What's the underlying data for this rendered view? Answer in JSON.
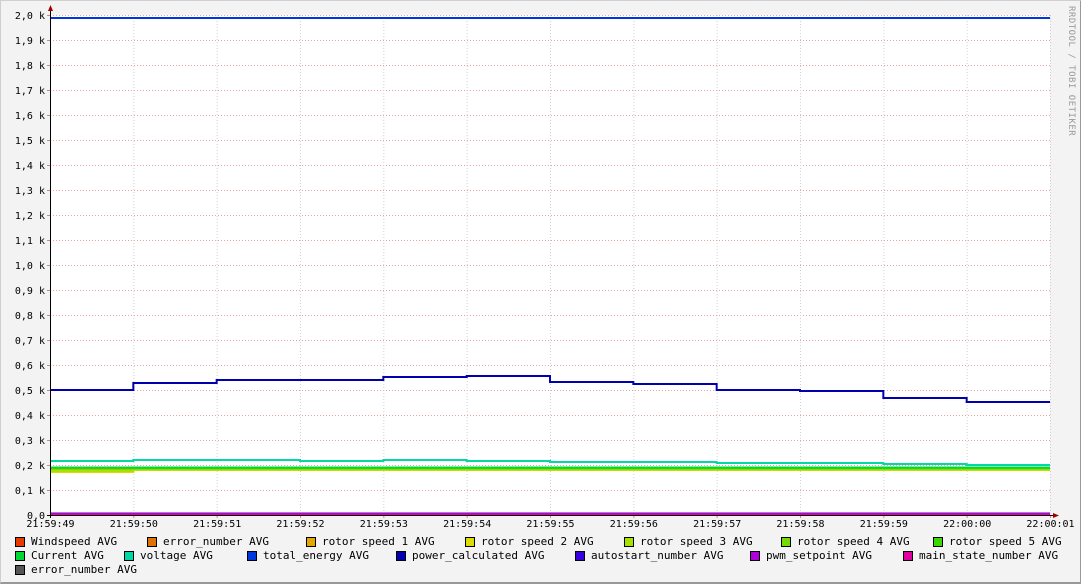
{
  "chart_data": {
    "type": "line",
    "title": "",
    "xlabel": "",
    "ylabel": "",
    "ylim": [
      0,
      2000
    ],
    "yticks": [
      0,
      100,
      200,
      300,
      400,
      500,
      600,
      700,
      800,
      900,
      1000,
      1100,
      1200,
      1300,
      1400,
      1500,
      1600,
      1700,
      1800,
      1900,
      2000
    ],
    "ytick_labels": [
      "0,0",
      "0,1 k",
      "0,2 k",
      "0,3 k",
      "0,4 k",
      "0,5 k",
      "0,6 k",
      "0,7 k",
      "0,8 k",
      "0,9 k",
      "1,0 k",
      "1,1 k",
      "1,2 k",
      "1,3 k",
      "1,4 k",
      "1,5 k",
      "1,6 k",
      "1,7 k",
      "1,8 k",
      "1,9 k",
      "2,0 k"
    ],
    "x": [
      "21:59:49",
      "21:59:50",
      "21:59:51",
      "21:59:52",
      "21:59:53",
      "21:59:54",
      "21:59:55",
      "21:59:56",
      "21:59:57",
      "21:59:58",
      "21:59:59",
      "22:00:00",
      "22:00:01"
    ],
    "grid": true,
    "legend_position": "bottom",
    "watermark": "RRDTOOL / TOBI OETIKER",
    "series": [
      {
        "name": "Windspeed AVG",
        "color": "#e83a00",
        "values": [
          null,
          null,
          null,
          null,
          null,
          null,
          null,
          null,
          null,
          null,
          null,
          null
        ]
      },
      {
        "name": "error_number AVG",
        "color": "#e07000",
        "values": [
          null,
          null,
          null,
          null,
          null,
          null,
          null,
          null,
          null,
          null,
          null,
          null
        ]
      },
      {
        "name": "rotor speed 1 AVG",
        "color": "#e0a800",
        "values": [
          184,
          184,
          184,
          184,
          184,
          184,
          184,
          184,
          184,
          184,
          184,
          184
        ]
      },
      {
        "name": "rotor speed 2 AVG",
        "color": "#dcdc00",
        "values": [
          172,
          180,
          180,
          180,
          180,
          180,
          180,
          180,
          180,
          180,
          180,
          180
        ]
      },
      {
        "name": "rotor speed 3 AVG",
        "color": "#a8e000",
        "values": [
          176,
          182,
          182,
          182,
          182,
          182,
          182,
          182,
          182,
          182,
          182,
          182
        ]
      },
      {
        "name": "rotor speed 4 AVG",
        "color": "#70dc00",
        "values": [
          186,
          186,
          186,
          186,
          186,
          186,
          186,
          186,
          186,
          186,
          186,
          186
        ]
      },
      {
        "name": "rotor speed 5 AVG",
        "color": "#38d800",
        "values": [
          188,
          188,
          188,
          188,
          188,
          188,
          188,
          188,
          188,
          188,
          188,
          188
        ]
      },
      {
        "name": "Current AVG",
        "color": "#00d838",
        "values": [
          190,
          190,
          190,
          190,
          190,
          190,
          190,
          190,
          190,
          190,
          190,
          190
        ]
      },
      {
        "name": "voltage AVG",
        "color": "#00d8a8",
        "values": [
          216,
          220,
          220,
          216,
          220,
          216,
          212,
          212,
          208,
          208,
          204,
          200
        ]
      },
      {
        "name": "total_energy AVG",
        "color": "#0038e0",
        "values": [
          1988,
          1988,
          1988,
          1988,
          1988,
          1988,
          1988,
          1988,
          1988,
          1988,
          1988,
          1988
        ]
      },
      {
        "name": "power_calculated AVG",
        "color": "#0000b0",
        "values": [
          500,
          528,
          540,
          540,
          552,
          556,
          532,
          524,
          500,
          496,
          468,
          452
        ]
      },
      {
        "name": "autostart_number AVG",
        "color": "#3800e0",
        "values": [
          6,
          6,
          6,
          6,
          6,
          6,
          6,
          6,
          6,
          6,
          6,
          6
        ]
      },
      {
        "name": "pwm_setpoint AVG",
        "color": "#b000d8",
        "values": [
          4,
          4,
          4,
          4,
          4,
          4,
          4,
          4,
          4,
          4,
          4,
          4
        ]
      },
      {
        "name": "main_state_number AVG",
        "color": "#e000a0",
        "values": [
          2,
          2,
          2,
          2,
          2,
          2,
          2,
          2,
          2,
          2,
          2,
          2
        ]
      },
      {
        "name": "error_number AVG",
        "color": "#555555",
        "values": [
          null,
          null,
          null,
          null,
          null,
          null,
          null,
          null,
          null,
          null,
          null,
          null
        ]
      }
    ]
  }
}
